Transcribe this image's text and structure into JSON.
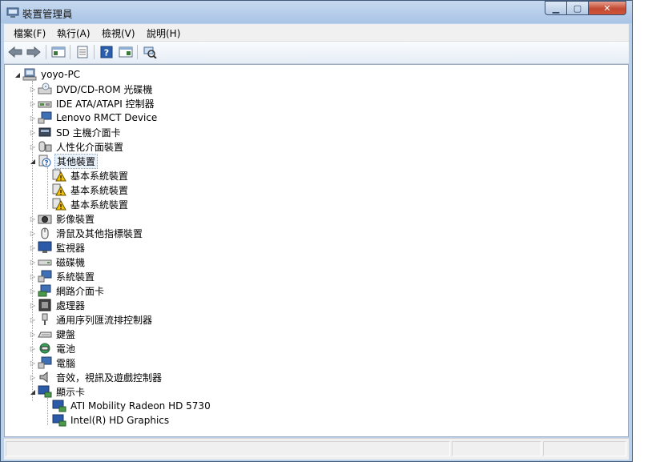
{
  "window": {
    "title": "裝置管理員",
    "controls": {
      "minimize": "▁",
      "maximize": "▢",
      "close": "✕"
    }
  },
  "menu": [
    "檔案(F)",
    "執行(A)",
    "檢視(V)",
    "說明(H)"
  ],
  "toolbar": [
    "back-icon",
    "forward-icon",
    "show-hide-tree-icon",
    "properties-icon",
    "help-icon",
    "action-pane-icon",
    "scan-hardware-icon"
  ],
  "tree": {
    "root": "yoyo-PC",
    "items": [
      {
        "label": "DVD/CD-ROM 光碟機",
        "icon": "dvd-drive-icon"
      },
      {
        "label": "IDE ATA/ATAPI 控制器",
        "icon": "ide-controller-icon"
      },
      {
        "label": "Lenovo RMCT Device",
        "icon": "lenovo-device-icon"
      },
      {
        "label": "SD 主機介面卡",
        "icon": "sd-host-icon"
      },
      {
        "label": "人性化介面裝置",
        "icon": "hid-icon"
      },
      {
        "label": "其他裝置",
        "icon": "unknown-device-icon",
        "children": [
          "基本系統裝置",
          "基本系統裝置",
          "基本系統裝置"
        ]
      },
      {
        "label": "影像裝置",
        "icon": "imaging-device-icon"
      },
      {
        "label": "滑鼠及其他指標裝置",
        "icon": "mouse-icon"
      },
      {
        "label": "監視器",
        "icon": "monitor-icon"
      },
      {
        "label": "磁碟機",
        "icon": "disk-drive-icon"
      },
      {
        "label": "系統裝置",
        "icon": "system-device-icon"
      },
      {
        "label": "網路介面卡",
        "icon": "network-adapter-icon"
      },
      {
        "label": "處理器",
        "icon": "processor-icon"
      },
      {
        "label": "通用序列匯流排控制器",
        "icon": "usb-controller-icon"
      },
      {
        "label": "鍵盤",
        "icon": "keyboard-icon"
      },
      {
        "label": "電池",
        "icon": "battery-icon"
      },
      {
        "label": "電腦",
        "icon": "computer-icon"
      },
      {
        "label": "音效，視訊及遊戲控制器",
        "icon": "sound-icon"
      },
      {
        "label": "顯示卡",
        "icon": "display-adapter-icon",
        "children": [
          "ATI Mobility Radeon HD 5730",
          "Intel(R) HD Graphics"
        ]
      }
    ]
  },
  "statusbar": [
    "",
    "",
    ""
  ],
  "colors": {
    "frame": "#b9d1ea",
    "close": "#c24a32",
    "warning": "#f2c200"
  }
}
